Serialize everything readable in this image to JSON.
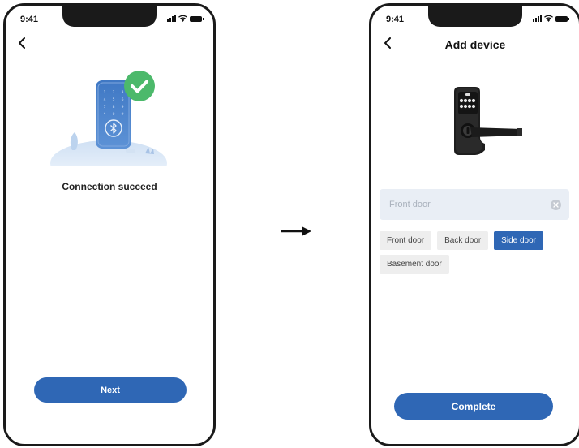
{
  "status_bar": {
    "time": "9:41"
  },
  "left_screen": {
    "message": "Connection succeed",
    "next_label": "Next",
    "keypad_keys": [
      "1",
      "2",
      "3",
      "4",
      "5",
      "6",
      "7",
      "8",
      "9",
      "*",
      "0",
      "#"
    ]
  },
  "right_screen": {
    "title": "Add device",
    "name_input": {
      "placeholder": "Front door",
      "value": ""
    },
    "suggestions": [
      {
        "label": "Front door",
        "selected": false
      },
      {
        "label": "Back door",
        "selected": false
      },
      {
        "label": "Side door",
        "selected": true
      },
      {
        "label": "Basement door",
        "selected": false
      }
    ],
    "complete_label": "Complete"
  },
  "colors": {
    "accent": "#2f67b5",
    "success": "#4cb96b",
    "chip_bg": "#eeeeee",
    "input_bg": "#e9eef5"
  },
  "icons": [
    "back-arrow-icon",
    "signal-icon",
    "wifi-icon",
    "battery-icon",
    "check-icon",
    "bluetooth-icon",
    "clear-icon",
    "flow-arrow-icon"
  ]
}
